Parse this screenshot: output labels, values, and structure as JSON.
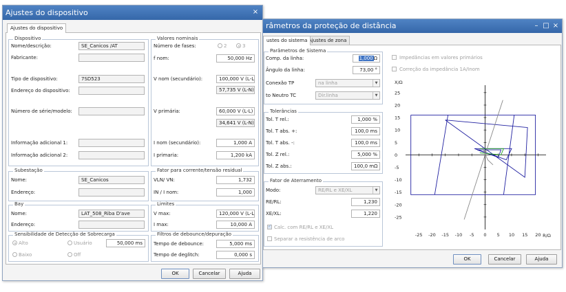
{
  "device_window": {
    "title": "Ajustes do dispositivo",
    "close_glyph": "×",
    "tab": "Ajustes do dispositivo",
    "dispositivo": {
      "title": "Dispositivo",
      "nome_label": "Nome/descrição:",
      "nome_value": "SE_Canicos /AT",
      "fabricante_label": "Fabricante:",
      "fabricante_value": "",
      "tipo_label": "Tipo de dispositivo:",
      "tipo_value": "7SD523",
      "endereco_label": "Endereço do dispositivo:",
      "endereco_value": "",
      "serie_label": "Número de série/modelo:",
      "serie_value": "",
      "info1_label": "Informação adicional 1:",
      "info1_value": "",
      "info2_label": "Informação adicional 2:",
      "info2_value": ""
    },
    "valores": {
      "title": "Valores nominais",
      "fases_label": "Número de fases:",
      "fases_opt1": "2",
      "fases_opt2": "3",
      "fnom_label": "f nom:",
      "fnom_value": "50,000  Hz",
      "vnom_label": "V nom (secundário):",
      "vnom_ll": "100,000  V (L-L)",
      "vnom_ln": "57,735  V (L-N)",
      "vprim_label": "V primária:",
      "vprim_ll": "60,000  V (L-L)",
      "vprim_ln": "34,641  V (L-N)",
      "inom_label": "I nom (secundário):",
      "inom_value": "1,000  A",
      "iprim_label": "I primaria:",
      "iprim_value": "1,200  kA"
    },
    "subestacao": {
      "title": "Subestação",
      "nome_label": "Nome:",
      "nome_value": "SE_Canicos",
      "endereco_label": "Endereço:",
      "endereco_value": ""
    },
    "fator": {
      "title": "Fator para corrente/tensão residual",
      "vln_label": "VLN/ VN:",
      "vln_value": "1,732",
      "in_label": "IN / I nom:",
      "in_value": "1,000"
    },
    "bay": {
      "title": "Bay",
      "nome_label": "Nome:",
      "nome_value": "LAT_508_Riba D'ave",
      "endereco_label": "Endereço:",
      "endereco_value": ""
    },
    "limites": {
      "title": "Limites",
      "vmax_label": "V max:",
      "vmax_value": "120,000  V (L-L)",
      "imax_label": "I max:",
      "imax_value": "10,000  A"
    },
    "sensibilidade": {
      "title": "Sensibilidade de Detecção de Sobrecarga",
      "alto": "Alto",
      "usuario": "Usuário",
      "usuario_value": "50,000  ms",
      "baixo": "Baixo",
      "off": "Off"
    },
    "filtros": {
      "title": "Filtros de debounce/depuração",
      "debounce_label": "Tempo de debounce:",
      "debounce_value": "5,000  ms",
      "deglitch_label": "Tempo de deglitch:",
      "deglitch_value": "0,000  s"
    },
    "buttons": {
      "ok": "OK",
      "cancel": "Cancelar",
      "help": "Ajuda"
    }
  },
  "distance_window": {
    "title": "râmetros da proteção de distância",
    "tab_sistema": "ustes do sistema",
    "tab_zona": "Ajustes de zona",
    "sistema": {
      "title": "Parâmetros de Sistema",
      "comp_label": "Comp. da linha:",
      "comp_value": "1,000",
      "comp_unit": "Ω",
      "angulo_label": "Ângulo da linha:",
      "angulo_value": "73,00 °",
      "conexao_label": "Conexão TP",
      "conexao_value": "na linha",
      "neutro_label": "to Neutro TC",
      "neutro_value": "Dir.linha"
    },
    "tolerancias": {
      "title": "Tolerâncias",
      "trel_label": "Tol. T rel.:",
      "trel_value": "1,000 %",
      "tabsp_label": "Tol. T abs. +:",
      "tabsp_value": "100,0 ms",
      "tabsm_label": "Tol. T abs. -:",
      "tabsm_value": "100,0 ms",
      "zrel_label": "Tol. Z rel.:",
      "zrel_value": "5,000 %",
      "zabs_label": "Tol. Z abs.:",
      "zabs_value": "100,0 mΩ"
    },
    "aterramento": {
      "title": "Fator de Aterramento",
      "modo_label": "Modo:",
      "modo_value": "RE/RL e XE/XL",
      "rerl_label": "RE/RL:",
      "rerl_value": "1,230",
      "xexl_label": "XE/XL:",
      "xexl_value": "1,220",
      "calc_label": "Calc. com RE/RL e XE/XL",
      "separar_label": "Separar a resistência de arco"
    },
    "options": {
      "impedancias": "Impedâncias em valores primários",
      "correcao": "Correção da impedância 1A/Inom"
    },
    "buttons": {
      "ok": "OK",
      "cancel": "Cancelar",
      "help": "Ajuda"
    }
  },
  "chart_data": {
    "type": "line",
    "xlabel": "R/Ω",
    "ylabel": "X/Ω",
    "xlim": [
      -30,
      23
    ],
    "ylim": [
      -30,
      28
    ],
    "xticks": [
      -25,
      -20,
      -15,
      -10,
      -5,
      0,
      5,
      10,
      15,
      20
    ],
    "yticks": [
      25,
      20,
      15,
      10,
      5,
      0,
      -5,
      -10,
      -15,
      -20,
      -25
    ],
    "grid": false,
    "series": [
      {
        "color": "#1f1fa0",
        "points": [
          [
            -28,
            16
          ],
          [
            19,
            16
          ],
          [
            19,
            -16
          ],
          [
            -28,
            -16
          ],
          [
            -28,
            16
          ]
        ]
      },
      {
        "color": "#1f1fa0",
        "points": [
          [
            -14,
            16
          ],
          [
            -19,
            -16
          ]
        ]
      },
      {
        "color": "#1f1fa0",
        "points": [
          [
            11,
            16
          ],
          [
            7,
            -16
          ]
        ]
      },
      {
        "color": "#1f1fa0",
        "points": [
          [
            -15,
            14
          ],
          [
            16,
            11
          ],
          [
            15,
            -9
          ],
          [
            -15,
            14
          ]
        ]
      },
      {
        "color": "#1f1fa0",
        "points": [
          [
            -4,
            2.5
          ],
          [
            10,
            2.5
          ],
          [
            8,
            -2
          ],
          [
            -4,
            2.5
          ]
        ]
      },
      {
        "color": "#1f1fa0",
        "points": [
          [
            -3,
            2
          ],
          [
            6,
            2
          ],
          [
            5,
            -1
          ],
          [
            -3,
            2
          ]
        ]
      },
      {
        "color": "#1fa01f",
        "points": [
          [
            -2,
            2.5
          ],
          [
            7,
            2.5
          ],
          [
            6,
            0
          ],
          [
            -2,
            0.8
          ]
        ]
      },
      {
        "color": "#8a8a8a",
        "points": [
          [
            -7.9,
            -26
          ],
          [
            6.7,
            22
          ]
        ]
      },
      {
        "color": "#8a8a8a",
        "points": [
          [
            -1,
            3
          ],
          [
            1,
            -2
          ],
          [
            3,
            -4
          ]
        ]
      }
    ]
  }
}
